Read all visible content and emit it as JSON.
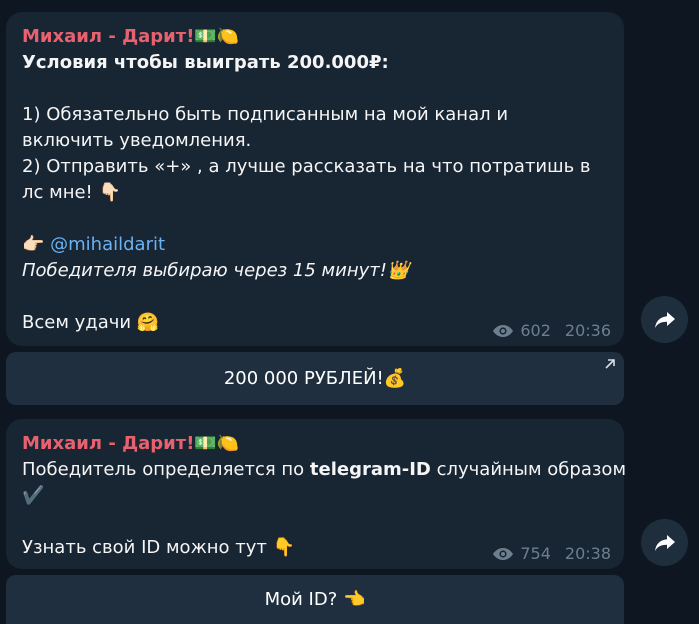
{
  "messages": [
    {
      "sender": "Михаил - Дарит!💵🍋",
      "lines": [
        "Условия чтобы выиграть 200.000₽:",
        "",
        "1) Обязательно быть подписанным на мой канал и",
        "включить уведомления.",
        "2) Отправить «+» , а лучше рассказать на что потратишь в",
        "лс мне! 👇🏻",
        "",
        "👉🏻 ",
        "Победителя выбираю через 15 минут!👑",
        "",
        "Всем удачи 🤗"
      ],
      "mention": "@mihaildarit",
      "views": "602",
      "time": "20:36",
      "button_label": "200 000 РУБЛЕЙ!💰"
    },
    {
      "sender": "Михаил - Дарит!💵🍋",
      "line1_pre": "Победитель определяется по ",
      "line1_bold": "telegram-ID",
      "line1_post": " случайным образом",
      "line2": "✔️",
      "line4": "Узнать свой ID можно тут 👇",
      "views": "754",
      "time": "20:38",
      "button_label": "Мой ID? 👈"
    }
  ],
  "colors": {
    "background": "#0e1621",
    "bubble": "#182533",
    "sender": "#e8616f",
    "link": "#6ab2f2",
    "meta": "#6d7f8f"
  },
  "icons": {
    "views": "eye-icon",
    "share": "share-arrow-icon",
    "external": "external-link-arrow-icon"
  }
}
